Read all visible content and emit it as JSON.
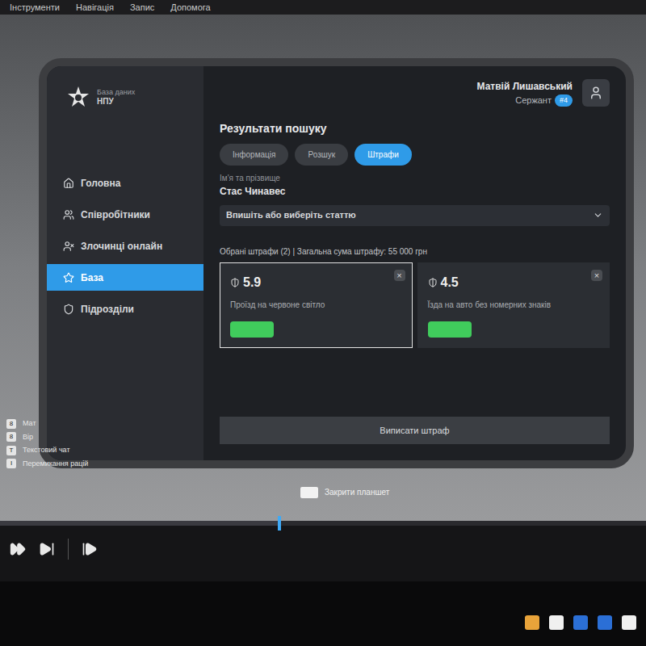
{
  "menu_bar": {
    "items": [
      "Інструменти",
      "Навігація",
      "Запис",
      "Допомога"
    ]
  },
  "tablet": {
    "app": {
      "title": "База даних",
      "subtitle": "НПУ"
    },
    "sidebar": {
      "items": [
        {
          "label": "Головна",
          "selected": false
        },
        {
          "label": "Співробітники",
          "selected": false
        },
        {
          "label": "Злочинці онлайн",
          "selected": false
        },
        {
          "label": "База",
          "selected": true
        },
        {
          "label": "Підрозділи",
          "selected": false
        }
      ]
    },
    "user": {
      "name": "Матвій Лишавський",
      "rank": "Сержант",
      "badge": "#4"
    },
    "search_results": {
      "title": "Результати пошуку",
      "tabs": [
        {
          "label": "Інформація",
          "selected": false
        },
        {
          "label": "Розшук",
          "selected": false
        },
        {
          "label": "Штрафи",
          "selected": true
        }
      ],
      "name_label": "Ім'я та прізвище",
      "name": "Стас Чинавес",
      "article_select": {
        "placeholder": "Впишіть або виберіть статтю"
      },
      "summary": "Обрані штрафи (2) | Загальна сума штрафу: 55 000 грн",
      "fines": [
        {
          "code": "5.9",
          "title": "Проїзд на червоне світло",
          "selected": true
        },
        {
          "code": "4.5",
          "title": "Їзда на авто без номерних знаків",
          "selected": false
        }
      ],
      "close_glyph": "×",
      "submit_button": "Виписати штраф"
    }
  },
  "close_hint": {
    "label": "Закрити планшет"
  },
  "key_hints": [
    {
      "key": "8",
      "label": "Мат"
    },
    {
      "key": "8",
      "label": "Вір"
    },
    {
      "key": "T",
      "label": "Текстовий чат"
    },
    {
      "key": "I",
      "label": "Перемикання рацій"
    }
  ],
  "player": {
    "level": 0.43
  },
  "taskbar": {
    "icons": [
      {
        "color": "#e8a33a"
      },
      {
        "color": "#f0f0f0"
      },
      {
        "color": "#2b6fd6"
      },
      {
        "color": "#2b6fd6"
      },
      {
        "color": "#f0f0f0"
      }
    ]
  }
}
